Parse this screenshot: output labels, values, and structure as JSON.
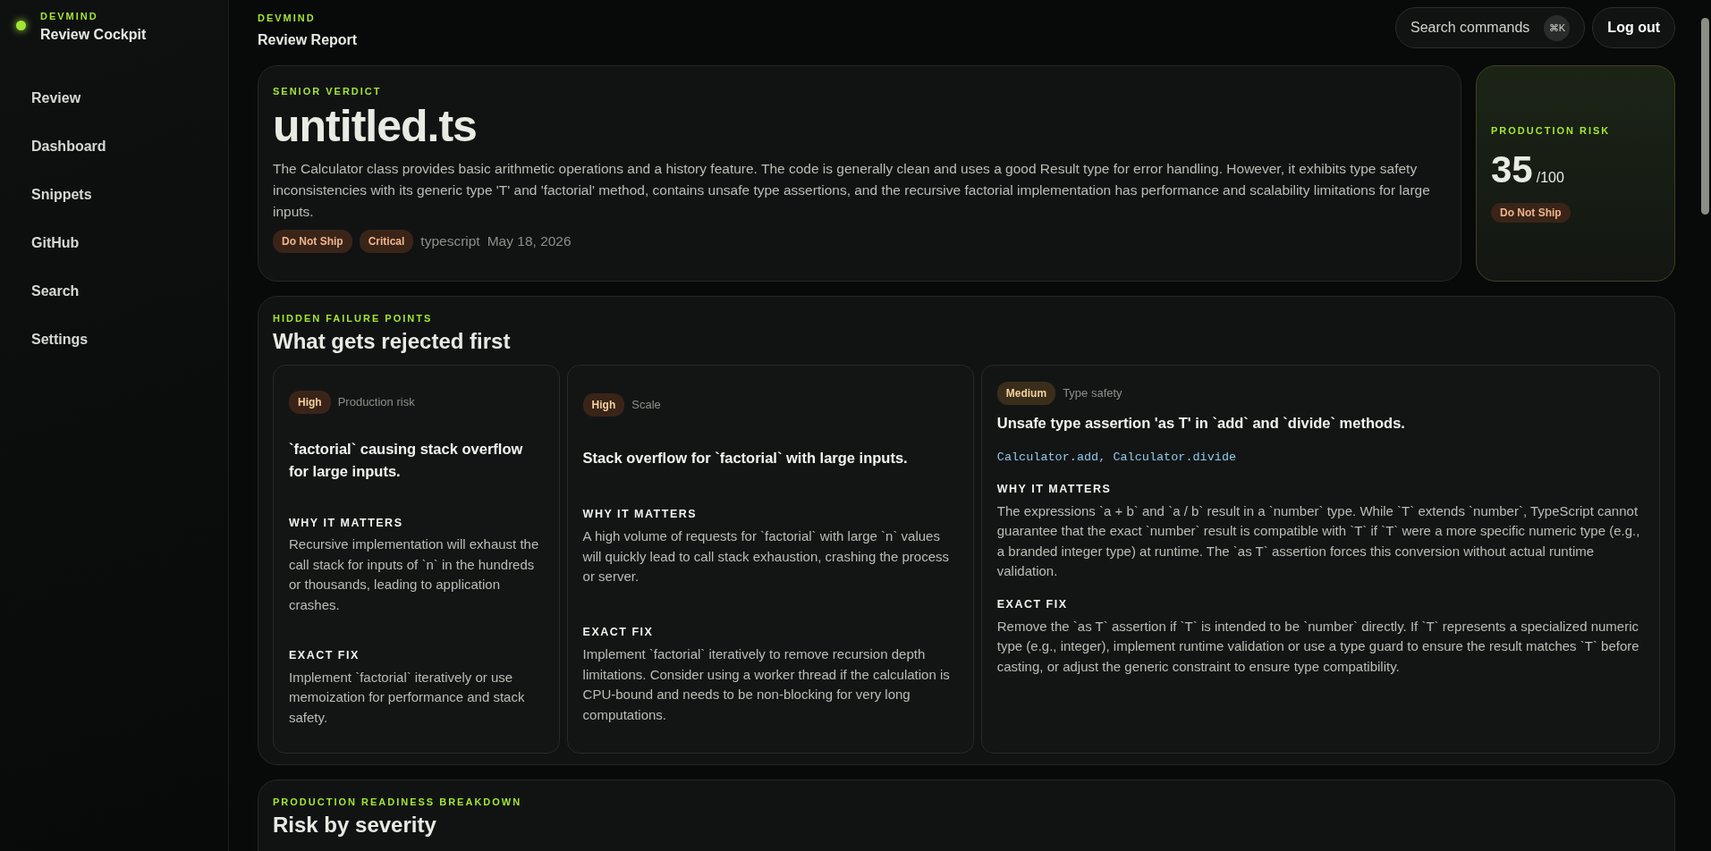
{
  "sidebar": {
    "brand": "DEVMIND",
    "title": "Review Cockpit",
    "status_on": true,
    "items": [
      {
        "label": "Review"
      },
      {
        "label": "Dashboard"
      },
      {
        "label": "Snippets"
      },
      {
        "label": "GitHub"
      },
      {
        "label": "Search"
      },
      {
        "label": "Settings"
      }
    ]
  },
  "header": {
    "eyebrow": "DEVMIND",
    "title": "Review Report",
    "search": {
      "label": "Search commands",
      "shortcut": "⌘K"
    },
    "logout": "Log out"
  },
  "verdict": {
    "eyebrow": "SENIOR VERDICT",
    "file": "untitled.ts",
    "summary": "The Calculator class provides basic arithmetic operations and a history feature. The code is generally clean and uses a good Result type for error handling. However, it exhibits type safety inconsistencies with its generic type 'T' and 'factorial' method, contains unsafe type assertions, and the recursive factorial implementation has performance and scalability limitations for large inputs.",
    "tags": [
      "Do Not Ship",
      "Critical"
    ],
    "language": "typescript",
    "date": "May 18, 2026"
  },
  "risk": {
    "eyebrow": "PRODUCTION RISK",
    "score": "35",
    "max": "/100",
    "tag": "Do Not Ship"
  },
  "failures": {
    "eyebrow": "HIDDEN FAILURE POINTS",
    "title": "What gets rejected first",
    "items": [
      {
        "severity": "High",
        "color": "#3a2418",
        "category": "Production risk",
        "title": "`factorial` causing stack overflow for large inputs.",
        "why_label": "WHY IT MATTERS",
        "why": "Recursive implementation will exhaust the call stack for inputs of `n` in the hundreds or thousands, leading to application crashes.",
        "fix_label": "EXACT FIX",
        "fix": "Implement `factorial` iteratively or use memoization for performance and stack safety."
      },
      {
        "severity": "High",
        "color": "#3a2418",
        "category": "Scale",
        "title": "Stack overflow for `factorial` with large inputs.",
        "why_label": "WHY IT MATTERS",
        "why": "A high volume of requests for `factorial` with large `n` values will quickly lead to call stack exhaustion, crashing the process or server.",
        "fix_label": "EXACT FIX",
        "fix": "Implement `factorial` iteratively to remove recursion depth limitations. Consider using a worker thread if the calculation is CPU-bound and needs to be non-blocking for very long computations."
      },
      {
        "severity": "Medium",
        "color": "#3a2e1a",
        "category": "Type safety",
        "title": "Unsafe type assertion 'as T' in `add` and `divide` methods.",
        "locations": "Calculator.add, Calculator.divide",
        "why_label": "WHY IT MATTERS",
        "why": "The expressions `a + b` and `a / b` result in a `number` type. While `T` extends `number`, TypeScript cannot guarantee that the exact `number` result is compatible with `T` if `T` were a more specific numeric type (e.g., a branded integer type) at runtime. The `as T` assertion forces this conversion without actual runtime validation.",
        "fix_label": "EXACT FIX",
        "fix": "Remove the `as T` assertion if `T` is intended to be `number` directly. If `T` represents a specialized numeric type (e.g., integer), implement runtime validation or use a type guard to ensure the result matches `T` before casting, or adjust the generic constraint to ensure type compatibility."
      }
    ]
  },
  "readiness": {
    "eyebrow": "PRODUCTION READINESS BREAKDOWN",
    "title": "Risk by severity"
  }
}
